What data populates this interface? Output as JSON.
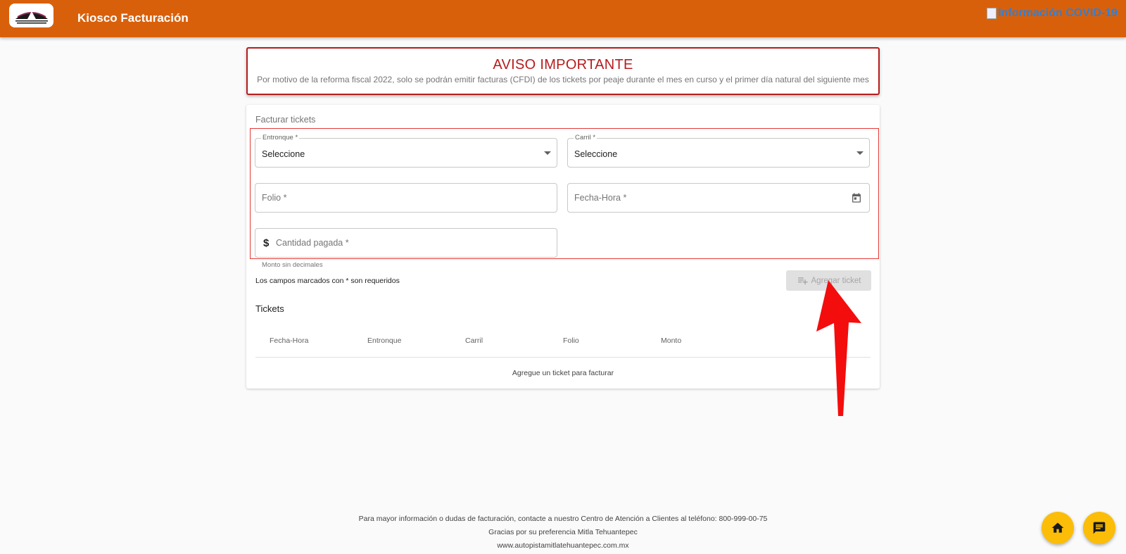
{
  "header": {
    "app_title": "Kiosco Facturación",
    "covid_link": "Información COVID-19",
    "brand_color": "#d9600a"
  },
  "notice": {
    "title": "AVISO IMPORTANTE",
    "text": "Por motivo de la reforma fiscal 2022, solo se podrán emitir facturas (CFDI) de los tickets por peaje durante el mes en curso y el primer día natural del siguiente mes"
  },
  "form": {
    "card_title": "Facturar tickets",
    "entronque": {
      "label": "Entronque *",
      "value": "Seleccione"
    },
    "carril": {
      "label": "Carril *",
      "value": "Seleccione"
    },
    "folio": {
      "placeholder": "Folio *"
    },
    "fecha_hora": {
      "placeholder": "Fecha-Hora *"
    },
    "cantidad": {
      "prefix": "$",
      "placeholder": "Cantidad pagada *",
      "hint": "Monto sin decimales"
    },
    "required_note": "Los campos marcados con * son requeridos",
    "add_button": "Agregar ticket"
  },
  "tickets": {
    "title": "Tickets",
    "columns": [
      "Fecha-Hora",
      "Entronque",
      "Carril",
      "Folio",
      "Monto"
    ],
    "empty_message": "Agregue un ticket para facturar"
  },
  "footer": {
    "line1": "Para mayor información o dudas de facturación, contacte a nuestro Centro de Atención a Clientes al teléfono: 800-999-00-75",
    "line2": "Gracias por su preferencia Mitla Tehuantepec",
    "line3": "www.autopistamitlatehuantepec.com.mx"
  },
  "icons": {
    "home": "home-icon",
    "chat": "chat-icon",
    "calendar": "calendar-icon",
    "dropdown": "chevron-down-icon",
    "add_ticket": "playlist-add-icon"
  }
}
